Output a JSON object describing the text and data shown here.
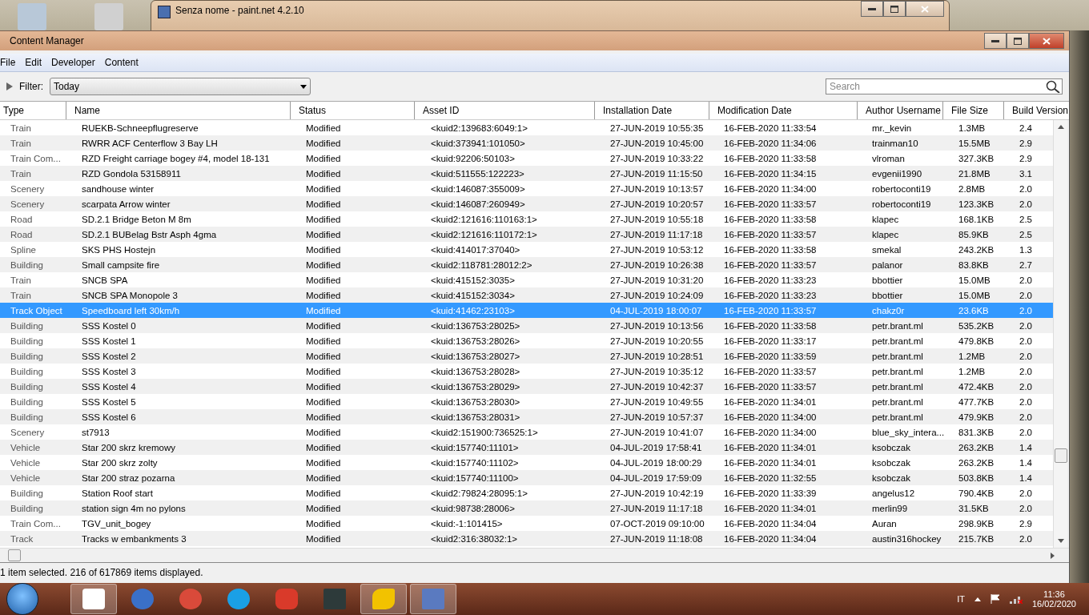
{
  "background_window": {
    "title": "Senza nome - paint.net 4.2.10"
  },
  "window": {
    "title": "Content Manager"
  },
  "menu": [
    "File",
    "Edit",
    "Developer",
    "Content"
  ],
  "filter": {
    "label": "Filter:",
    "value": "Today"
  },
  "search": {
    "placeholder": "Search"
  },
  "table": {
    "columns": [
      "Type",
      "Name",
      "Status",
      "Asset ID",
      "Installation Date",
      "Modification Date",
      "Author Username",
      "File Size",
      "Build Version"
    ],
    "rows": [
      {
        "cells": [
          "Train",
          "RUEKB-Schneepflugreserve",
          "Modified",
          "<kuid2:139683:6049:1>",
          "27-JUN-2019 10:55:35",
          "16-FEB-2020 11:33:54",
          "mr._kevin",
          "1.3MB",
          "2.4"
        ],
        "selected": false
      },
      {
        "cells": [
          "Train",
          "RWRR ACF Centerflow 3 Bay LH",
          "Modified",
          "<kuid:373941:101050>",
          "27-JUN-2019 10:45:00",
          "16-FEB-2020 11:34:06",
          "trainman10",
          "15.5MB",
          "2.9"
        ],
        "selected": false
      },
      {
        "cells": [
          "Train Com...",
          "RZD Freight carriage bogey #4, model 18-131",
          "Modified",
          "<kuid:92206:50103>",
          "27-JUN-2019 10:33:22",
          "16-FEB-2020 11:33:58",
          "vlroman",
          "327.3KB",
          "2.9"
        ],
        "selected": false
      },
      {
        "cells": [
          "Train",
          "RZD Gondola 53158911",
          "Modified",
          "<kuid:511555:122223>",
          "27-JUN-2019 11:15:50",
          "16-FEB-2020 11:34:15",
          "evgenii1990",
          "21.8MB",
          "3.1"
        ],
        "selected": false
      },
      {
        "cells": [
          "Scenery",
          "sandhouse winter",
          "Modified",
          "<kuid:146087:355009>",
          "27-JUN-2019 10:13:57",
          "16-FEB-2020 11:34:00",
          "robertoconti19",
          "2.8MB",
          "2.0"
        ],
        "selected": false
      },
      {
        "cells": [
          "Scenery",
          "scarpata Arrow winter",
          "Modified",
          "<kuid:146087:260949>",
          "27-JUN-2019 10:20:57",
          "16-FEB-2020 11:33:57",
          "robertoconti19",
          "123.3KB",
          "2.0"
        ],
        "selected": false
      },
      {
        "cells": [
          "Road",
          "SD.2.1 Bridge Beton M 8m",
          "Modified",
          "<kuid2:121616:110163:1>",
          "27-JUN-2019 10:55:18",
          "16-FEB-2020 11:33:58",
          "klapec",
          "168.1KB",
          "2.5"
        ],
        "selected": false
      },
      {
        "cells": [
          "Road",
          "SD.2.1 BUBelag Bstr Asph 4gma",
          "Modified",
          "<kuid2:121616:110172:1>",
          "27-JUN-2019 11:17:18",
          "16-FEB-2020 11:33:57",
          "klapec",
          "85.9KB",
          "2.5"
        ],
        "selected": false
      },
      {
        "cells": [
          "Spline",
          "SKS PHS Hostejn",
          "Modified",
          "<kuid:414017:37040>",
          "27-JUN-2019 10:53:12",
          "16-FEB-2020 11:33:58",
          "smekal",
          "243.2KB",
          "1.3"
        ],
        "selected": false
      },
      {
        "cells": [
          "Building",
          "Small campsite fire",
          "Modified",
          "<kuid2:118781:28012:2>",
          "27-JUN-2019 10:26:38",
          "16-FEB-2020 11:33:57",
          "palanor",
          "83.8KB",
          "2.7"
        ],
        "selected": false
      },
      {
        "cells": [
          "Train",
          "SNCB SPA",
          "Modified",
          "<kuid:415152:3035>",
          "27-JUN-2019 10:31:20",
          "16-FEB-2020 11:33:23",
          "bbottier",
          "15.0MB",
          "2.0"
        ],
        "selected": false
      },
      {
        "cells": [
          "Train",
          "SNCB SPA Monopole 3",
          "Modified",
          "<kuid:415152:3034>",
          "27-JUN-2019 10:24:09",
          "16-FEB-2020 11:33:23",
          "bbottier",
          "15.0MB",
          "2.0"
        ],
        "selected": false
      },
      {
        "cells": [
          "Track Object",
          "Speedboard left 30km/h",
          "Modified",
          "<kuid:41462:23103>",
          "04-JUL-2019 18:00:07",
          "16-FEB-2020 11:33:57",
          "chakz0r",
          "23.6KB",
          "2.0"
        ],
        "selected": true
      },
      {
        "cells": [
          "Building",
          "SSS Kostel 0",
          "Modified",
          "<kuid:136753:28025>",
          "27-JUN-2019 10:13:56",
          "16-FEB-2020 11:33:58",
          "petr.brant.ml",
          "535.2KB",
          "2.0"
        ],
        "selected": false
      },
      {
        "cells": [
          "Building",
          "SSS Kostel 1",
          "Modified",
          "<kuid:136753:28026>",
          "27-JUN-2019 10:20:55",
          "16-FEB-2020 11:33:17",
          "petr.brant.ml",
          "479.8KB",
          "2.0"
        ],
        "selected": false
      },
      {
        "cells": [
          "Building",
          "SSS Kostel 2",
          "Modified",
          "<kuid:136753:28027>",
          "27-JUN-2019 10:28:51",
          "16-FEB-2020 11:33:59",
          "petr.brant.ml",
          "1.2MB",
          "2.0"
        ],
        "selected": false
      },
      {
        "cells": [
          "Building",
          "SSS Kostel 3",
          "Modified",
          "<kuid:136753:28028>",
          "27-JUN-2019 10:35:12",
          "16-FEB-2020 11:33:57",
          "petr.brant.ml",
          "1.2MB",
          "2.0"
        ],
        "selected": false
      },
      {
        "cells": [
          "Building",
          "SSS Kostel 4",
          "Modified",
          "<kuid:136753:28029>",
          "27-JUN-2019 10:42:37",
          "16-FEB-2020 11:33:57",
          "petr.brant.ml",
          "472.4KB",
          "2.0"
        ],
        "selected": false
      },
      {
        "cells": [
          "Building",
          "SSS Kostel 5",
          "Modified",
          "<kuid:136753:28030>",
          "27-JUN-2019 10:49:55",
          "16-FEB-2020 11:34:01",
          "petr.brant.ml",
          "477.7KB",
          "2.0"
        ],
        "selected": false
      },
      {
        "cells": [
          "Building",
          "SSS Kostel 6",
          "Modified",
          "<kuid:136753:28031>",
          "27-JUN-2019 10:57:37",
          "16-FEB-2020 11:34:00",
          "petr.brant.ml",
          "479.9KB",
          "2.0"
        ],
        "selected": false
      },
      {
        "cells": [
          "Scenery",
          "st7913",
          "Modified",
          "<kuid2:151900:736525:1>",
          "27-JUN-2019 10:41:07",
          "16-FEB-2020 11:34:00",
          "blue_sky_intera...",
          "831.3KB",
          "2.0"
        ],
        "selected": false
      },
      {
        "cells": [
          "Vehicle",
          "Star 200 skrz kremowy",
          "Modified",
          "<kuid:157740:11101>",
          "04-JUL-2019 17:58:41",
          "16-FEB-2020 11:34:01",
          "ksobczak",
          "263.2KB",
          "1.4"
        ],
        "selected": false
      },
      {
        "cells": [
          "Vehicle",
          "Star 200 skrz zolty",
          "Modified",
          "<kuid:157740:11102>",
          "04-JUL-2019 18:00:29",
          "16-FEB-2020 11:34:01",
          "ksobczak",
          "263.2KB",
          "1.4"
        ],
        "selected": false
      },
      {
        "cells": [
          "Vehicle",
          "Star 200 straz pozarna",
          "Modified",
          "<kuid:157740:11100>",
          "04-JUL-2019 17:59:09",
          "16-FEB-2020 11:32:55",
          "ksobczak",
          "503.8KB",
          "1.4"
        ],
        "selected": false
      },
      {
        "cells": [
          "Building",
          "Station Roof start",
          "Modified",
          "<kuid2:79824:28095:1>",
          "27-JUN-2019 10:42:19",
          "16-FEB-2020 11:33:39",
          "angelus12",
          "790.4KB",
          "2.0"
        ],
        "selected": false
      },
      {
        "cells": [
          "Building",
          "station sign 4m no pylons",
          "Modified",
          "<kuid:98738:28006>",
          "27-JUN-2019 11:17:18",
          "16-FEB-2020 11:34:01",
          "merlin99",
          "31.5KB",
          "2.0"
        ],
        "selected": false
      },
      {
        "cells": [
          "Train Com...",
          "TGV_unit_bogey",
          "Modified",
          "<kuid:-1:101415>",
          "07-OCT-2019 09:10:00",
          "16-FEB-2020 11:34:04",
          "Auran",
          "298.9KB",
          "2.9"
        ],
        "selected": false
      },
      {
        "cells": [
          "Track",
          "Tracks w embankments 3",
          "Modified",
          "<kuid2:316:38032:1>",
          "27-JUN-2019 11:18:08",
          "16-FEB-2020 11:34:04",
          "austin316hockey",
          "215.7KB",
          "2.0"
        ],
        "selected": false
      }
    ]
  },
  "status_bar": "1 item selected. 216 of 617869 items displayed.",
  "taskbar": {
    "language": "IT",
    "time": "11:36",
    "date": "16/02/2020"
  }
}
